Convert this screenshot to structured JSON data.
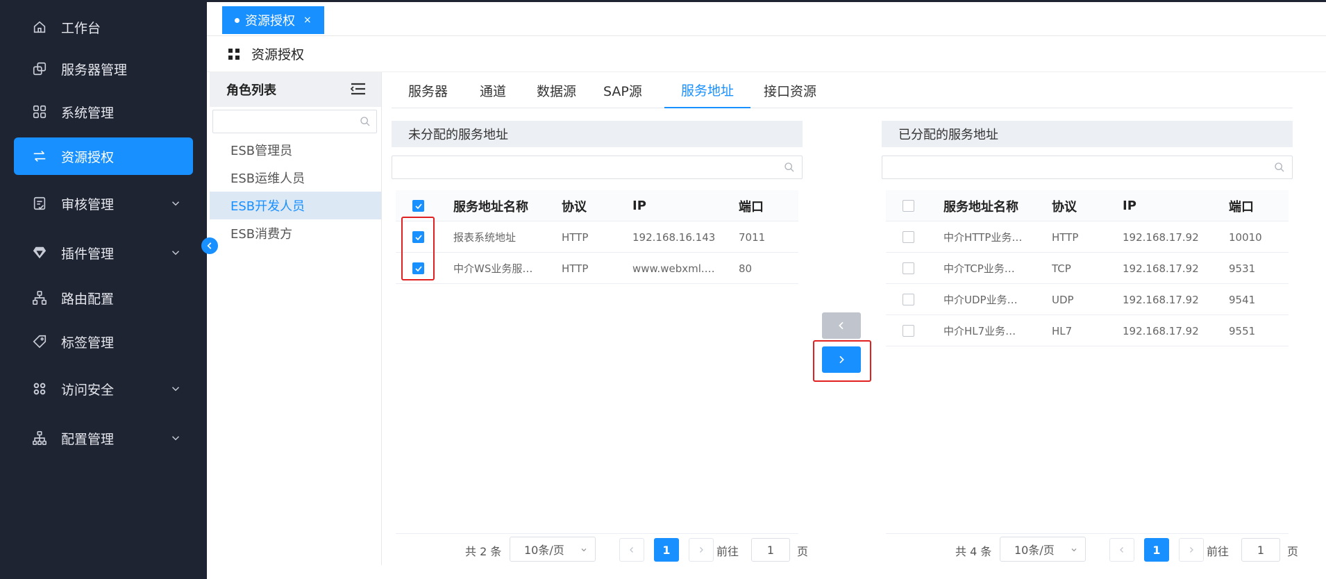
{
  "sidebar": {
    "items": [
      {
        "label": "工作台"
      },
      {
        "label": "服务器管理"
      },
      {
        "label": "系统管理"
      },
      {
        "label": "资源授权"
      },
      {
        "label": "审核管理"
      },
      {
        "label": "插件管理"
      },
      {
        "label": "路由配置"
      },
      {
        "label": "标签管理"
      },
      {
        "label": "访问安全"
      },
      {
        "label": "配置管理"
      }
    ]
  },
  "top_tab": {
    "label": "资源授权",
    "close": "×"
  },
  "page_title": "资源授权",
  "role_panel": {
    "title": "角色列表",
    "search_placeholder": "",
    "roles": [
      "ESB管理员",
      "ESB运维人员",
      "ESB开发人员",
      "ESB消费方"
    ]
  },
  "tabs": [
    "服务器",
    "通道",
    "数据源",
    "SAP源",
    "服务地址",
    "接口资源"
  ],
  "left_box": {
    "title": "未分配的服务地址",
    "columns": [
      "服务地址名称",
      "协议",
      "IP",
      "端口"
    ],
    "rows": [
      {
        "name": "报表系统地址",
        "protocol": "HTTP",
        "ip": "192.168.16.143",
        "port": "7011"
      },
      {
        "name": "中介WS业务服…",
        "protocol": "HTTP",
        "ip": "www.webxml.…",
        "port": "80"
      }
    ],
    "pager": {
      "total": "共 2 条",
      "page_size": "10条/页",
      "page": "1",
      "goto": "前往",
      "goto_value": "1",
      "page_suffix": "页"
    }
  },
  "right_box": {
    "title": "已分配的服务地址",
    "columns": [
      "服务地址名称",
      "协议",
      "IP",
      "端口"
    ],
    "rows": [
      {
        "name": "中介HTTP业务…",
        "protocol": "HTTP",
        "ip": "192.168.17.92",
        "port": "10010"
      },
      {
        "name": "中介TCP业务…",
        "protocol": "TCP",
        "ip": "192.168.17.92",
        "port": "9531"
      },
      {
        "name": "中介UDP业务…",
        "protocol": "UDP",
        "ip": "192.168.17.92",
        "port": "9541"
      },
      {
        "name": "中介HL7业务…",
        "protocol": "HL7",
        "ip": "192.168.17.92",
        "port": "9551"
      }
    ],
    "pager": {
      "total": "共 4 条",
      "page_size": "10条/页",
      "page": "1",
      "goto": "前往",
      "goto_value": "1",
      "page_suffix": "页"
    }
  },
  "colors": {
    "sidebar_bg": "#1f2433",
    "accent": "#1890ff",
    "highlight": "#e02020"
  }
}
